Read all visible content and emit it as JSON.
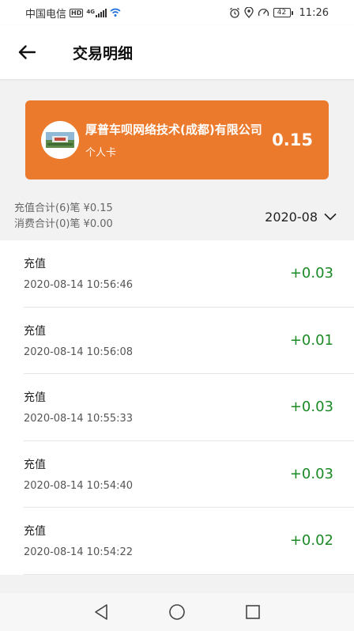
{
  "status_bar": {
    "carrier": "中国电信",
    "hd_badge": "HD",
    "network_badge": "4G",
    "battery": "42",
    "time": "11:26"
  },
  "header": {
    "title": "交易明细",
    "back_icon": "arrow-left-icon"
  },
  "card": {
    "company_name": "厚普车呗网络技术(成都)有限公司",
    "card_type": "个人卡",
    "balance": "0.15",
    "bg_color": "#ec7a2d"
  },
  "summary": {
    "recharge_total": "充值合计(6)笔 ¥0.15",
    "consume_total": "消费合计(0)笔 ¥0.00",
    "month": "2020-08"
  },
  "transactions": [
    {
      "type": "充值",
      "time": "2020-08-14 10:56:46",
      "amount": "+0.03"
    },
    {
      "type": "充值",
      "time": "2020-08-14 10:56:08",
      "amount": "+0.01"
    },
    {
      "type": "充值",
      "time": "2020-08-14 10:55:33",
      "amount": "+0.03"
    },
    {
      "type": "充值",
      "time": "2020-08-14 10:54:40",
      "amount": "+0.03"
    },
    {
      "type": "充值",
      "time": "2020-08-14 10:54:22",
      "amount": "+0.02"
    }
  ],
  "colors": {
    "accent": "#ec7a2d",
    "positive_amount": "#1a8a24"
  },
  "nav_bar": {
    "icons": [
      "back-triangle-icon",
      "home-circle-icon",
      "recents-square-icon"
    ]
  }
}
